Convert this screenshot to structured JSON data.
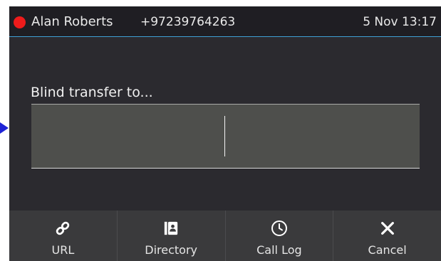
{
  "status_bar": {
    "caller_name": "Alan Roberts",
    "caller_number": "+97239764263",
    "datetime": "5 Nov 13:17",
    "call_indicator_color": "#ee1b1b",
    "divider_color": "#3ea1d6"
  },
  "transfer": {
    "prompt": "Blind transfer to...",
    "input_value": ""
  },
  "softkeys": [
    {
      "label": "URL",
      "icon": "link-icon"
    },
    {
      "label": "Directory",
      "icon": "contact-book-icon"
    },
    {
      "label": "Call Log",
      "icon": "clock-icon"
    },
    {
      "label": "Cancel",
      "icon": "close-icon"
    }
  ],
  "focus_indicator_color": "#1f24d6"
}
